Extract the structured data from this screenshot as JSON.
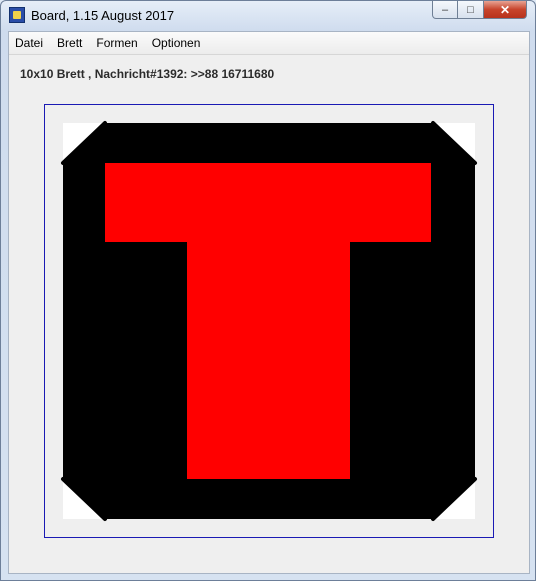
{
  "window": {
    "title": "Board, 1.15 August 2017",
    "icon": "board-app-icon",
    "buttons": {
      "minimize": "–",
      "maximize": "□",
      "close": "✕"
    }
  },
  "menu": {
    "items": [
      "Datei",
      "Brett",
      "Formen",
      "Optionen"
    ]
  },
  "status": {
    "text": "10x10 Brett , Nachricht#1392: >>88 16711680"
  },
  "board": {
    "rows": 10,
    "cols": 10,
    "background_color": "#000000",
    "shape_color": "#ff0000",
    "corner_color": "#ffffff",
    "frame_color": "#1a1ab4",
    "shape": "T"
  }
}
